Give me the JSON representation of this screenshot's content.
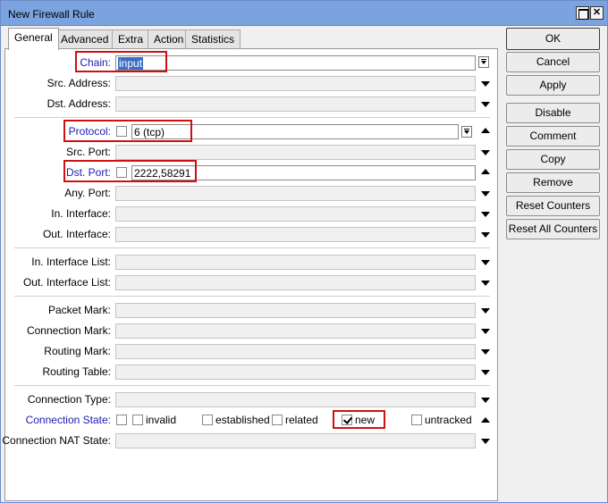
{
  "window": {
    "title": "New Firewall Rule"
  },
  "tabs": [
    "General",
    "Advanced",
    "Extra",
    "Action",
    "Statistics"
  ],
  "fields": {
    "chain": {
      "label": "Chain:",
      "value": "input"
    },
    "src_address": {
      "label": "Src. Address:"
    },
    "dst_address": {
      "label": "Dst. Address:"
    },
    "protocol": {
      "label": "Protocol:",
      "value": "6 (tcp)"
    },
    "src_port": {
      "label": "Src. Port:"
    },
    "dst_port": {
      "label": "Dst. Port:",
      "value": "2222,58291"
    },
    "any_port": {
      "label": "Any. Port:"
    },
    "in_interface": {
      "label": "In. Interface:"
    },
    "out_interface": {
      "label": "Out. Interface:"
    },
    "in_interface_list": {
      "label": "In. Interface List:"
    },
    "out_interface_list": {
      "label": "Out. Interface List:"
    },
    "packet_mark": {
      "label": "Packet Mark:"
    },
    "connection_mark": {
      "label": "Connection Mark:"
    },
    "routing_mark": {
      "label": "Routing Mark:"
    },
    "routing_table": {
      "label": "Routing Table:"
    },
    "connection_type": {
      "label": "Connection Type:"
    },
    "connection_state": {
      "label": "Connection State:",
      "options": [
        "invalid",
        "established",
        "related",
        "new",
        "untracked"
      ],
      "checked": [
        "new"
      ]
    },
    "connection_nat_state": {
      "label": "Connection NAT State:"
    }
  },
  "buttons": {
    "ok": "OK",
    "cancel": "Cancel",
    "apply": "Apply",
    "disable": "Disable",
    "comment": "Comment",
    "copy": "Copy",
    "remove": "Remove",
    "reset_counters": "Reset Counters",
    "reset_all_counters": "Reset All Counters"
  },
  "colors": {
    "highlight": "#d01010",
    "label_link": "#1b1bb5",
    "titlebar": "#7aa3df"
  }
}
